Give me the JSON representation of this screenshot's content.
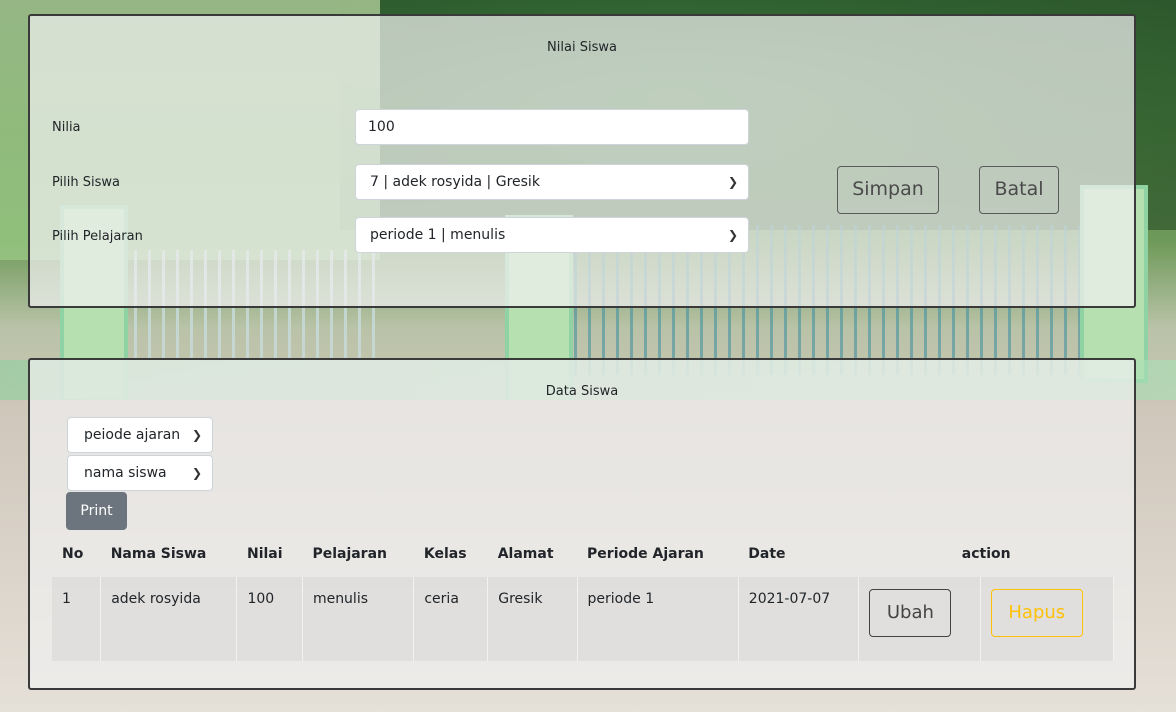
{
  "form": {
    "title": "Nilai Siswa",
    "label_nilai": "Nilia",
    "label_siswa": "Pilih Siswa",
    "label_pelajaran": "Pilih Pelajaran",
    "value_nilai": "100",
    "value_siswa": "7 | adek rosyida | Gresik",
    "value_pelajaran": "periode 1 | menulis",
    "save_label": "Simpan",
    "cancel_label": "Batal"
  },
  "data_section": {
    "title": "Data Siswa",
    "filter_periode": "peiode ajaran",
    "filter_nama": "nama siswa",
    "print_label": "Print",
    "headers": [
      "No",
      "Nama Siswa",
      "Nilai",
      "Pelajaran",
      "Kelas",
      "Alamat",
      "Periode Ajaran",
      "Date",
      "action"
    ],
    "rows": [
      {
        "no": "1",
        "nama": "adek rosyida",
        "nilai": "100",
        "pelajaran": "menulis",
        "kelas": "ceria",
        "alamat": "Gresik",
        "periode": "periode 1",
        "date": "2021-07-07",
        "edit_label": "Ubah",
        "delete_label": "Hapus"
      }
    ]
  },
  "icons": {
    "dropdown": "chevron-down-icon"
  },
  "colors": {
    "print_button": "#6c757d",
    "delete_button": "#ffc107"
  }
}
